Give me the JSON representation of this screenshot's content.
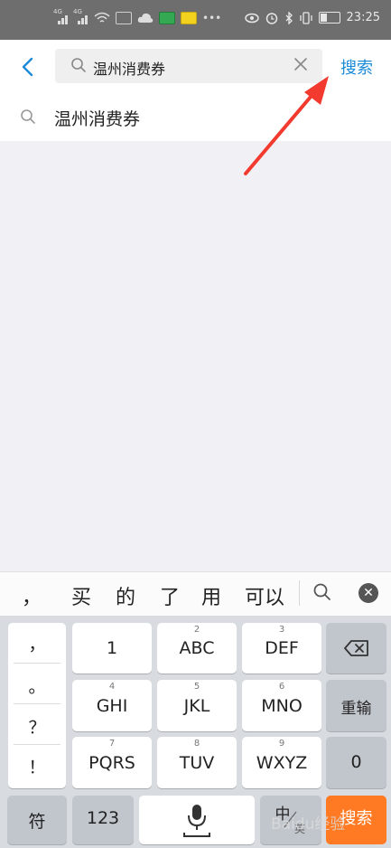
{
  "status_bar": {
    "time": "23:25",
    "net1": "4G",
    "net2": "4G"
  },
  "header": {
    "query": "温州消费券",
    "search_button": "搜索"
  },
  "suggestion": {
    "text": "温州消费券"
  },
  "candidates": {
    "items": [
      "，",
      "买",
      "的",
      "了",
      "用",
      "可以"
    ]
  },
  "keyboard": {
    "punct": [
      "，",
      "。",
      "？",
      "！"
    ],
    "keys": [
      {
        "sup": "",
        "label": "1"
      },
      {
        "sup": "2",
        "label": "ABC"
      },
      {
        "sup": "3",
        "label": "DEF"
      },
      {
        "sup": "4",
        "label": "GHI"
      },
      {
        "sup": "5",
        "label": "JKL"
      },
      {
        "sup": "6",
        "label": "MNO"
      },
      {
        "sup": "7",
        "label": "PQRS"
      },
      {
        "sup": "8",
        "label": "TUV"
      },
      {
        "sup": "9",
        "label": "WXYZ"
      }
    ],
    "rechord": "重输",
    "zero": "0",
    "fu": "符",
    "num": "123",
    "lang_top": "中",
    "lang_bottom": "英",
    "search": "搜索",
    "watermark": "Baidu经验"
  },
  "colors": {
    "accent": "#1b8ad8",
    "search_key": "#ff7a22",
    "arrow": "#f23a2f"
  },
  "icons": [
    "back-icon",
    "search-icon",
    "clear-icon",
    "backspace-icon",
    "mic-icon",
    "close-icon"
  ]
}
